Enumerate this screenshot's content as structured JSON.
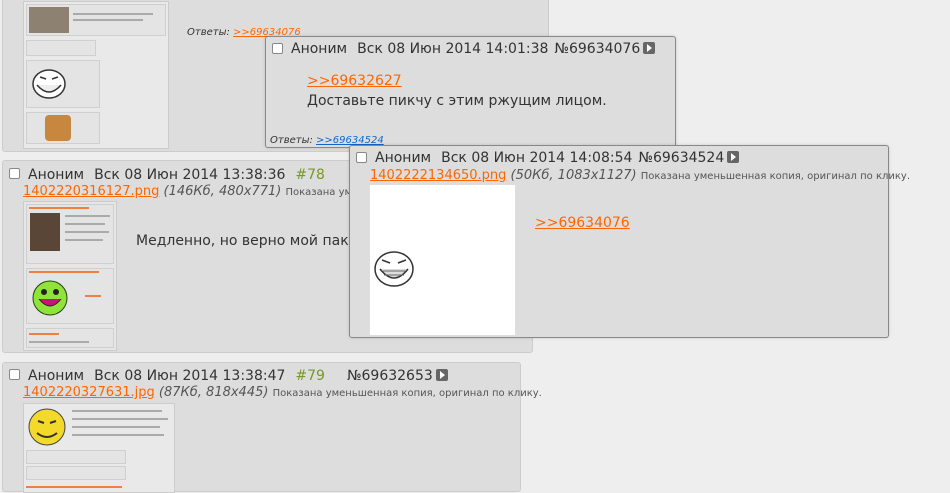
{
  "post_top": {
    "answers_label": "Ответы:",
    "answers_link": ">>69634076"
  },
  "post_78": {
    "author": "Аноним",
    "date": "Вск 08 Июн 2014 13:38:36",
    "postnum": "#78",
    "file_name": "1402220316127.png",
    "file_meta": "(146Кб, 480x771)",
    "file_note": "Показана умень",
    "message": "Медленно, но верно мой пак"
  },
  "post_79": {
    "author": "Аноним",
    "date": "Вск 08 Июн 2014 13:38:47",
    "postnum": "#79",
    "id": "№69632653",
    "file_name": "1402220327631.jpg",
    "file_meta": "(87Кб, 818x445)",
    "file_note": "Показана уменьшенная копия, оригинал по клику."
  },
  "popup_1": {
    "author": "Аноним",
    "date": "Вск 08 Июн 2014 14:01:38",
    "id": "№69634076",
    "reply_link": ">>69632627",
    "message": "Доставьте пикчу с этим ржущим лицом.",
    "answers_label": "Ответы:",
    "answers_link": ">>69634524"
  },
  "popup_2": {
    "author": "Аноним",
    "date": "Вск 08 Июн 2014 14:08:54",
    "id": "№69634524",
    "file_name": "1402222134650.png",
    "file_meta": "(50Кб, 1083x1127)",
    "file_note": "Показана уменьшенная копия, оригинал по клику.",
    "reply_link": ">>69634076"
  },
  "colors": {
    "background": "#eeeeee",
    "post_background": "#dddddd",
    "link_orange": "#ff6600",
    "postnum_green": "#789922",
    "answers_link_blue": "#1166cc"
  }
}
